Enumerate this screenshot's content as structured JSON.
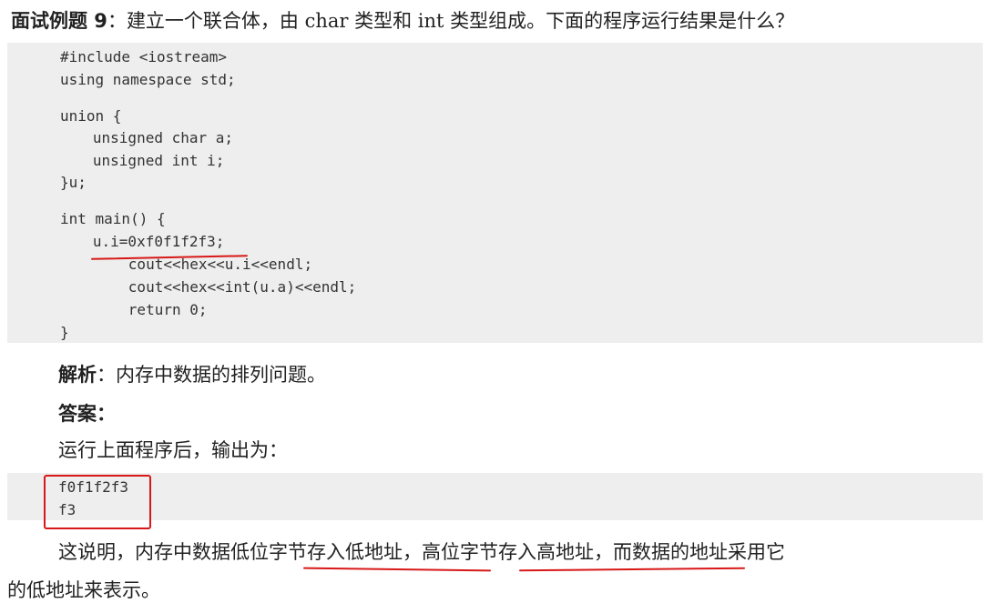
{
  "question": {
    "label": "面试例题 9",
    "colon": "：",
    "text": "建立一个联合体，由 char 类型和 int 类型组成。下面的程序运行结果是什么？"
  },
  "code": {
    "lines": [
      "#include <iostream>",
      "using namespace std;",
      "union {",
      "   unsigned char a;",
      "   unsigned int i;",
      "}u;",
      "int main() {",
      "   u.i=0xf0f1f2f3;",
      "      cout<<hex<<u.i<<endl;",
      "      cout<<hex<<int(u.a)<<endl;",
      "      return 0;",
      "}"
    ]
  },
  "analysis": {
    "label": "解析",
    "text": "：内存中数据的排列问题。"
  },
  "answer": {
    "label": "答案："
  },
  "output_intro": "运行上面程序后，输出为：",
  "output": {
    "lines": [
      "f0f1f2f3",
      "f3"
    ]
  },
  "explanation": {
    "line1_part1": "这说明，内存中数据低",
    "line1_part2": "位字节存入低地址",
    "line1_part3": "，",
    "line1_part4": "高位字节存入高地址",
    "line1_part5": "，而数据的地址采用它",
    "line2": "的低地址来表示。"
  },
  "annotation_color": "#d81818"
}
